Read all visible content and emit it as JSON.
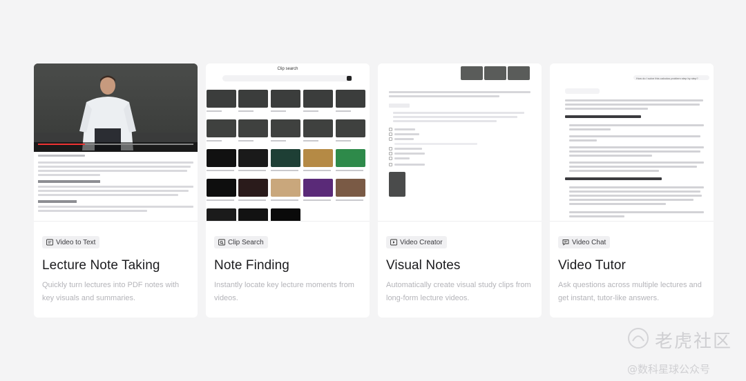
{
  "cards": [
    {
      "tag": "Video to Text",
      "tag_icon": "document-lines-icon",
      "title": "Lecture Note Taking",
      "description": "Quickly turn lectures into PDF notes with key visuals and summaries."
    },
    {
      "tag": "Clip Search",
      "tag_icon": "clip-search-icon",
      "title": "Note Finding",
      "description": "Instantly locate key lecture moments from videos."
    },
    {
      "tag": "Video Creator",
      "tag_icon": "video-create-icon",
      "title": "Visual Notes",
      "description": "Automatically create visual study clips from long-form lecture videos."
    },
    {
      "tag": "Video Chat",
      "tag_icon": "chat-icon",
      "title": "Video Tutor",
      "description": "Ask questions across multiple lectures and get instant, tutor-like answers."
    }
  ],
  "previews": {
    "clip_search_title": "Clip search",
    "video_tutor_question": "How do I solve this calculus problem step by step?",
    "video_tutor_thinking": "Thinking complete",
    "video_tutor_h1": "1. Understand and Analyze the Problem",
    "video_tutor_h2": "2. Formulate a Strategy and Recall Relevant Concepts"
  },
  "watermark": {
    "line1": "老虎社区",
    "line2": "@数科星球公众号"
  }
}
